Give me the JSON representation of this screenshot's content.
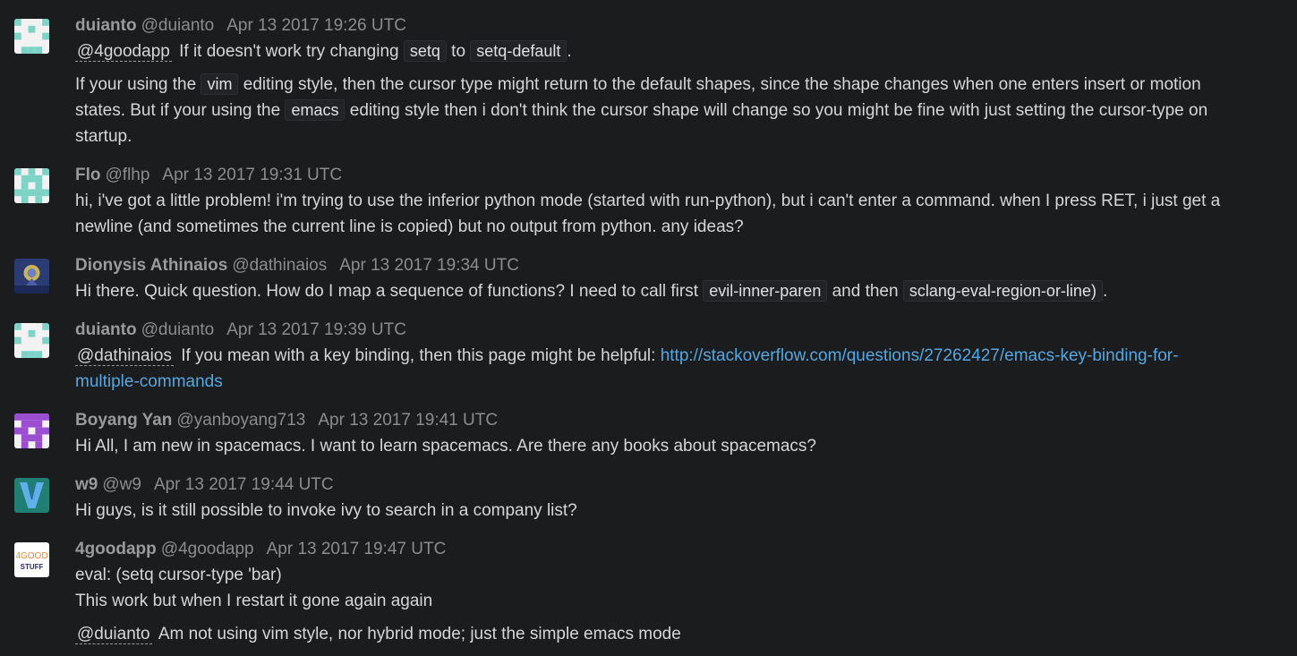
{
  "messages": [
    {
      "name": "duianto",
      "handle": "@duianto",
      "time": "Apr 13 2017 19:26 UTC",
      "avatar_icon": "identicon-teal-icon",
      "l1_mention": "@4goodapp",
      "l1_t1": " If it doesn't work try changing ",
      "l1_c1": "setq",
      "l1_t2": " to ",
      "l1_c2": "setq-default",
      "l1_t3": ".",
      "p2_t1": "If your using the ",
      "p2_c1": "vim",
      "p2_t2": " editing style, then the cursor type might return to the default shapes, since the shape changes when one enters insert or motion",
      "p3_t1": "states. But if your using the ",
      "p3_c1": "emacs",
      "p3_t2": " editing style then i don't think the cursor shape will change so you might be fine with just setting the cursor-type on",
      "p4_t1": "startup."
    },
    {
      "name": "Flo",
      "handle": "@flhp",
      "time": "Apr 13 2017 19:31 UTC",
      "avatar_icon": "identicon-teal-icon",
      "l1": "hi, i've got a little problem! i'm trying to use the inferior python mode (started with run-python), but i can't enter a command. when I press RET, i just get a",
      "l2": "newline (and sometimes the current line is copied) but no output from python. any ideas?"
    },
    {
      "name": "Dionysis Athinaios",
      "handle": "@dathinaios",
      "time": "Apr 13 2017 19:34 UTC",
      "avatar_icon": "photo-avatar-icon",
      "t1": "Hi there. Quick question. How do I map a sequence of functions? I need to call first ",
      "c1": "evil-inner-paren",
      "t2": " and then ",
      "c2": "sclang-eval-region-or-line)",
      "t3": "."
    },
    {
      "name": "duianto",
      "handle": "@duianto",
      "time": "Apr 13 2017 19:39 UTC",
      "avatar_icon": "identicon-teal-icon",
      "mention": "@dathinaios",
      "t1": " If you mean with a key binding, then this page might be helpful: ",
      "link1": "http://stackoverflow.com/questions/27262427/emacs-key-binding-for-",
      "link2": "multiple-commands"
    },
    {
      "name": "Boyang Yan",
      "handle": "@yanboyang713",
      "time": "Apr 13 2017 19:41 UTC",
      "avatar_icon": "identicon-purple-icon",
      "l1": "Hi All, I am new in spacemacs. I want to learn spacemacs. Are there any books about spacemacs?"
    },
    {
      "name": "w9",
      "handle": "@w9",
      "time": "Apr 13 2017 19:44 UTC",
      "avatar_icon": "v-logo-icon",
      "l1": "Hi guys, is it still possible to invoke ivy to search in a company list?"
    },
    {
      "name": "4goodapp",
      "handle": "@4goodapp",
      "time": "Apr 13 2017 19:47 UTC",
      "avatar_icon": "4good-stuff-logo-icon",
      "avatar_text1": "4GOOD",
      "avatar_text2": "STUFF",
      "l1": "eval: (setq cursor-type 'bar)",
      "l2": "This work but when I restart it gone again again",
      "mention": "@duianto",
      "l3": " Am not using vim style, nor hybrid mode; just the simple emacs mode"
    }
  ],
  "colors": {
    "background": "#1b1c1e",
    "text": "#d6d6d6",
    "meta": "#8c8c8c",
    "link": "#56a7e1"
  }
}
